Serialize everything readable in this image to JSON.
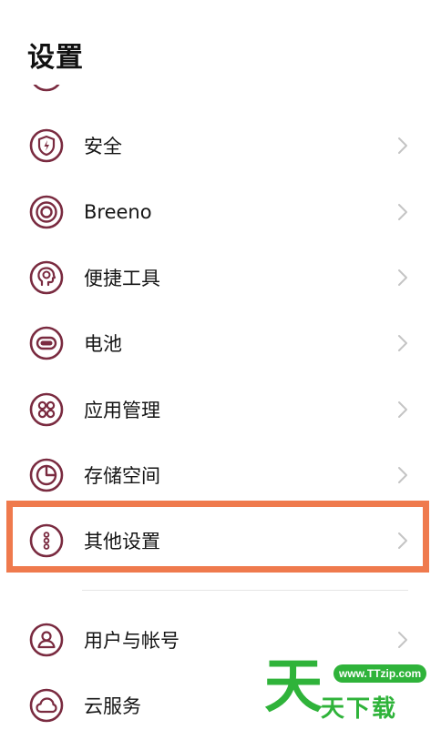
{
  "header": {
    "title": "设置"
  },
  "settings_items": [
    {
      "label": "安全",
      "icon": "security-shield-icon"
    },
    {
      "label": "Breeno",
      "icon": "breeno-icon"
    },
    {
      "label": "便捷工具",
      "icon": "convenience-tools-icon"
    },
    {
      "label": "电池",
      "icon": "battery-icon"
    },
    {
      "label": "应用管理",
      "icon": "app-management-icon"
    },
    {
      "label": "存储空间",
      "icon": "storage-icon"
    },
    {
      "label": "其他设置",
      "icon": "more-settings-icon"
    },
    {
      "label": "用户与帐号",
      "icon": "user-account-icon"
    },
    {
      "label": "云服务",
      "icon": "cloud-service-icon"
    }
  ],
  "highlighted_item": "其他设置",
  "colors": {
    "icon_accent": "#7a2b40",
    "highlight_border": "#ef7a4d",
    "chevron": "#c4c4c4",
    "watermark": "#2fb33a"
  },
  "watermark": {
    "big_char": "天",
    "url": "www.TTzip.com",
    "name": "天下载"
  }
}
